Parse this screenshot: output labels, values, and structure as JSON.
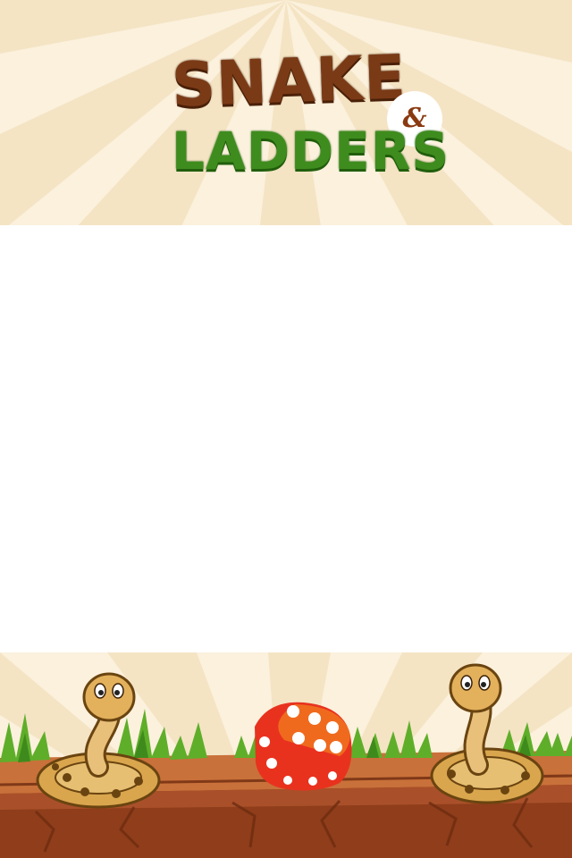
{
  "title": {
    "line1": "SNAKE",
    "connector": "&",
    "line2": "LADDERS"
  },
  "colors": {
    "background": "#fbf1dd",
    "ray": "#f3e1bd",
    "title_snake": "#7b3a16",
    "title_ladders": "#3f8c1e",
    "board": "#ffffff",
    "soil": "#b8562a",
    "grass": "#5fae2a",
    "dice": "#e8321e"
  },
  "icons": {
    "left_snake": "cartoon-snake-icon",
    "dice": "dice-icon",
    "right_snake": "cartoon-snake-icon"
  }
}
